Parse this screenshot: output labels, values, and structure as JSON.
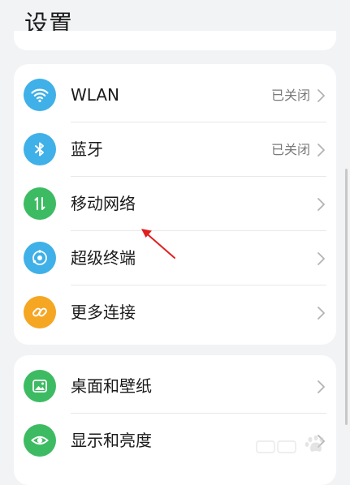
{
  "header": {
    "title": "设置"
  },
  "network_group": {
    "items": [
      {
        "label": "WLAN",
        "status": "已关闭",
        "icon": "wifi-icon",
        "icon_color": "#3fb0e8"
      },
      {
        "label": "蓝牙",
        "status": "已关闭",
        "icon": "bluetooth-icon",
        "icon_color": "#3fb0e8"
      },
      {
        "label": "移动网络",
        "status": "",
        "icon": "mobile-data-icon",
        "icon_color": "#3dbb63"
      },
      {
        "label": "超级终端",
        "status": "",
        "icon": "super-device-icon",
        "icon_color": "#3fb0e8"
      },
      {
        "label": "更多连接",
        "status": "",
        "icon": "link-icon",
        "icon_color": "#f5a623"
      }
    ]
  },
  "display_group": {
    "items": [
      {
        "label": "桌面和壁纸",
        "status": "",
        "icon": "wallpaper-icon",
        "icon_color": "#3dbb63"
      },
      {
        "label": "显示和亮度",
        "status": "",
        "icon": "eye-icon",
        "icon_color": "#3dbb63"
      }
    ]
  },
  "annotation": {
    "arrow_color": "#e02020"
  },
  "watermark": {
    "icon": "baidu-paw-icon"
  }
}
